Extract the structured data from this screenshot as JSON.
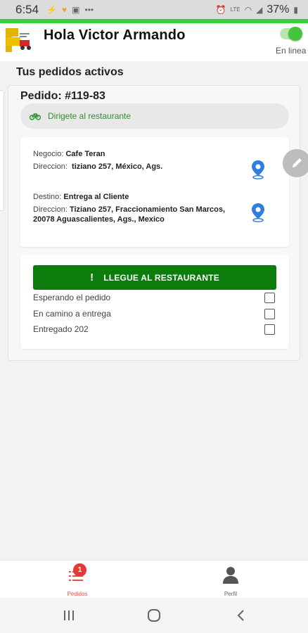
{
  "status_bar": {
    "time": "6:54",
    "battery": "37%"
  },
  "header": {
    "greeting": "Hola Victor Armando",
    "online_label": "En linea"
  },
  "section_title": "Tus pedidos activos",
  "order": {
    "title": "Pedido: #119-83",
    "status_text": "Dirigete al restaurante",
    "business_label": "Negocio:",
    "business_value": "Cafe Teran",
    "business_address_label": "Direccion:",
    "business_address_value": " tiziano 257, México, Ags.",
    "destination_label": "Destino:",
    "destination_value": "Entrega al Cliente",
    "destination_address_label": "Direccion:",
    "destination_address_line1": "Tiziano 257, Fraccionamiento San Marcos,",
    "destination_address_line2": "20078 Aguascalientes, Ags., Mexico",
    "primary_action_label": "LLEGUE AL RESTAURANTE",
    "checklist": [
      {
        "label": "Esperando el pedido",
        "checked": false
      },
      {
        "label": "En camino a entrega",
        "checked": false
      },
      {
        "label": "Entregado 202",
        "checked": false
      }
    ]
  },
  "bottom_nav": {
    "orders_label": "Pedidos",
    "orders_badge": "1",
    "profile_label": "Perfil"
  },
  "colors": {
    "accent_green": "#3ad03a",
    "button_green": "#0c7d0c",
    "status_text_green": "#2f8f2f",
    "pin_blue": "#2f7de0",
    "badge_red": "#e53935",
    "active_nav_red": "#f04d45"
  },
  "icons": {
    "status_pill": "bicycle-icon",
    "location": "map-pin-icon",
    "edit": "pencil-icon",
    "button": "exclamation-icon",
    "nav_orders": "list-icon",
    "nav_profile": "person-icon"
  }
}
